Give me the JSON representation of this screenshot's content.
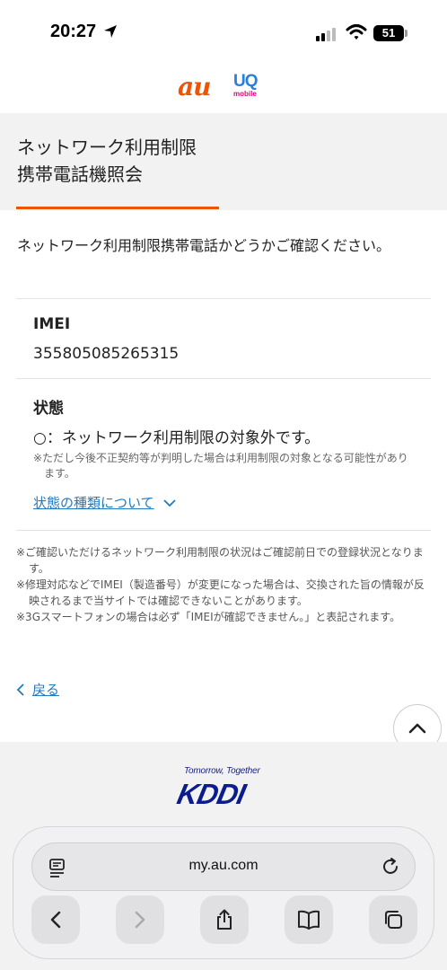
{
  "status_bar": {
    "time": "20:27",
    "battery": "51"
  },
  "brand": {
    "au_logo": "au",
    "uq_logo": "UQ",
    "uq_sub": "mobile"
  },
  "page": {
    "title_line1": "ネットワーク利用制限",
    "title_line2": "携帯電話機照会",
    "intro": "ネットワーク利用制限携帯電話かどうかご確認ください。"
  },
  "result": {
    "imei_label": "IMEI",
    "imei_value": "355805085265315",
    "status_label": "状態",
    "status_value": "○：ネットワーク利用制限の対象外です。",
    "status_note": "※ただし今後不正契約等が判明した場合は利用制限の対象となる可能性があります。",
    "status_types_link": "状態の種類について"
  },
  "notes": [
    "※ご確認いただけるネットワーク利用制限の状況はご確認前日での登録状況となります。",
    "※修理対応などでIMEI（製造番号）が変更になった場合は、交換された旨の情報が反映されるまで当サイトでは確認できないことがあります。",
    "※3Gスマートフォンの場合は必ず「IMEIが確認できません。」と表記されます。"
  ],
  "back_link": "戻る",
  "footer": {
    "tagline": "Tomorrow, Together",
    "logo": "KDDI"
  },
  "browser": {
    "url": "my.au.com"
  },
  "icons": [
    "location-arrow-icon",
    "signal-icon",
    "wifi-icon",
    "battery-icon",
    "chevron-down-icon",
    "chevron-left-icon",
    "chevron-up-icon",
    "reader-icon",
    "reload-icon",
    "back-icon",
    "forward-icon",
    "share-icon",
    "bookmarks-icon",
    "tabs-icon"
  ],
  "colors": {
    "accent": "#eb5505",
    "link": "#1f7ac1",
    "panel": "#f2f2f2"
  }
}
